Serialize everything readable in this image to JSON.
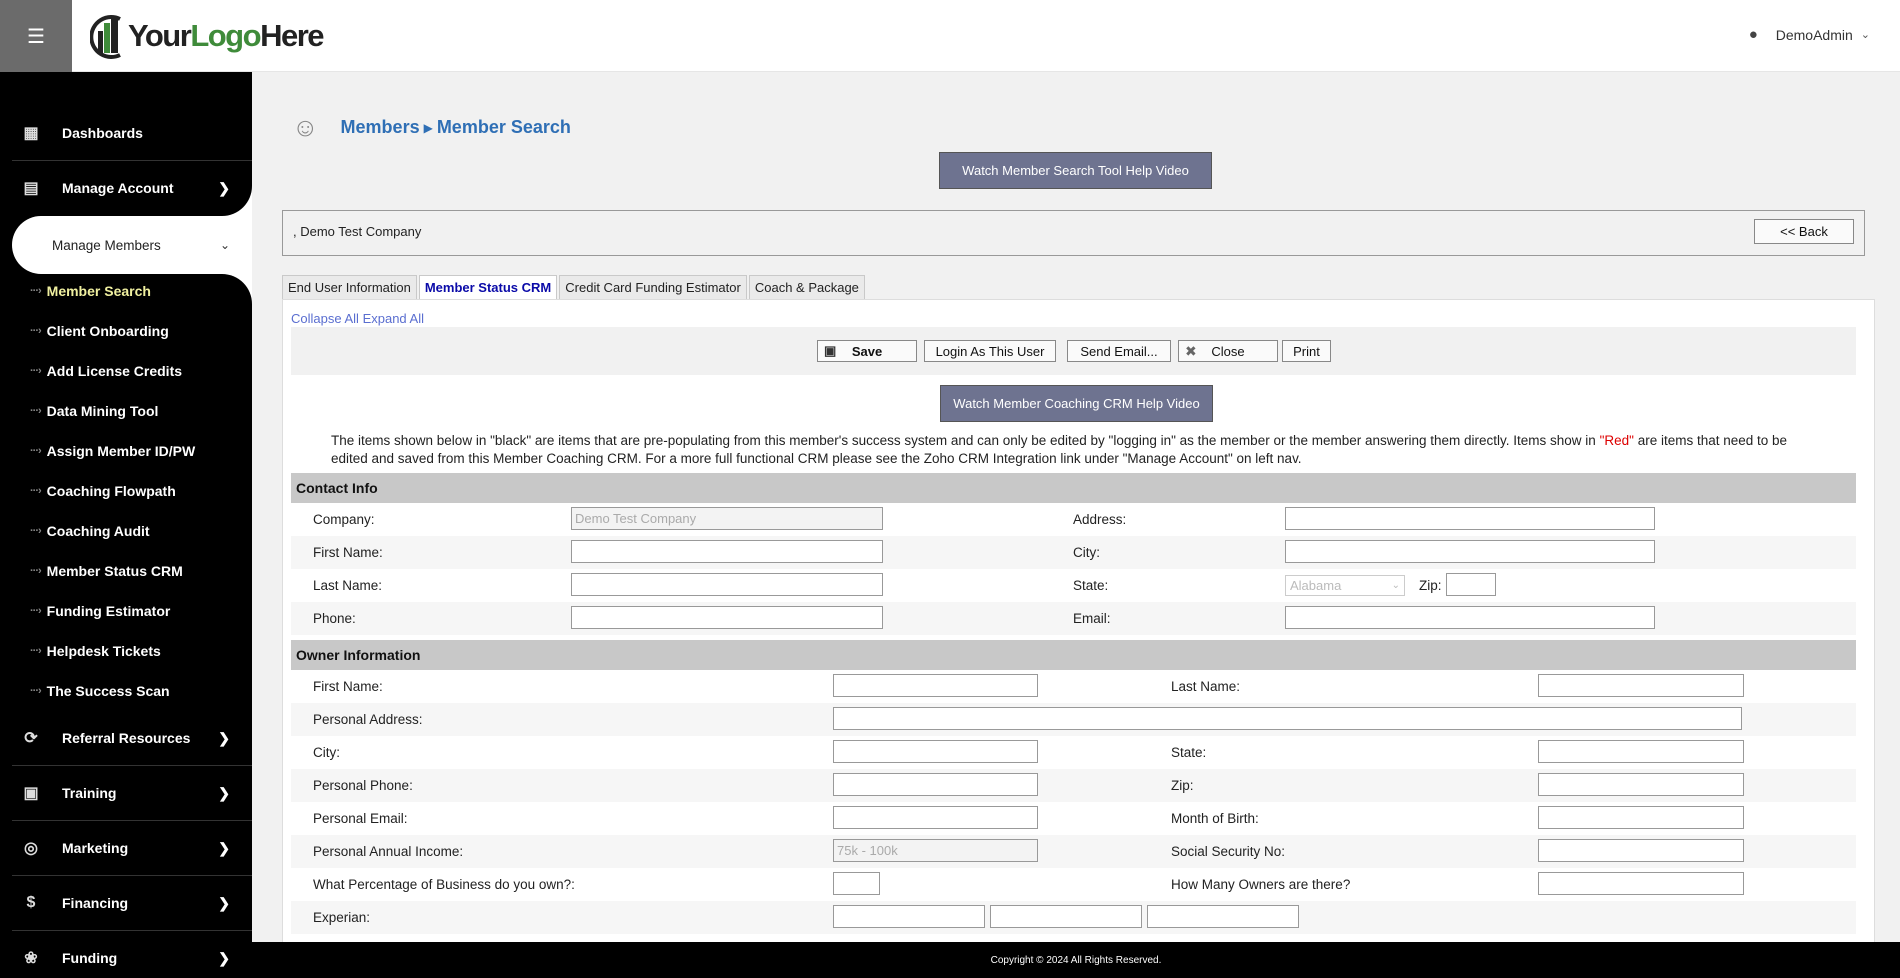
{
  "header": {
    "user_name": "DemoAdmin",
    "logo": {
      "your": "Your",
      "logo": "Logo",
      "here": "Here"
    }
  },
  "sidebar": {
    "items": [
      {
        "label": "Dashboards",
        "icon": "dashboard-grid-icon"
      },
      {
        "label": "Manage Account",
        "icon": "chart-icon"
      },
      {
        "label": "Manage Members"
      },
      {
        "label": "Referral Resources",
        "icon": "referral-icon"
      },
      {
        "label": "Training",
        "icon": "presentation-icon"
      },
      {
        "label": "Marketing",
        "icon": "target-icon"
      },
      {
        "label": "Financing",
        "icon": "money-icon"
      },
      {
        "label": "Funding",
        "icon": "funding-icon"
      }
    ],
    "subitems": [
      "Member Search",
      "Client Onboarding",
      "Add License Credits",
      "Data Mining Tool",
      "Assign Member ID/PW",
      "Coaching Flowpath",
      "Coaching Audit",
      "Member Status CRM",
      "Funding Estimator",
      "Helpdesk Tickets",
      "The Success Scan"
    ]
  },
  "breadcrumb": {
    "part1": "Members",
    "part2": "Member Search"
  },
  "help_video_button": "Watch Member Search Tool Help Video",
  "company_bar": {
    "name": ", Demo Test Company",
    "back_label": "<< Back"
  },
  "tabs": [
    "End User Information",
    "Member Status CRM",
    "Credit Card Funding Estimator",
    "Coach & Package"
  ],
  "panel": {
    "collapse_all": "Collapse All",
    "expand_all": "Expand All",
    "buttons": {
      "save": "Save",
      "login_as": "Login As This User",
      "send_email": "Send Email...",
      "close": "Close",
      "print": "Print"
    },
    "coaching_video_button": "Watch Member Coaching CRM Help Video",
    "note_part1": "The items shown below in \"black\" are items that are pre-populating from this member's success system and can only be edited by \"logging in\" as the member or the member answering them directly. Items show in ",
    "note_red": "\"Red\"",
    "note_part2": " are items that need to be edited and saved from this Member Coaching CRM. For a more full functional CRM please see the Zoho CRM Integration link under \"Manage Account\" on left nav."
  },
  "contact_info": {
    "title": "Contact Info",
    "company_label": "Company:",
    "company_value": "Demo Test Company",
    "first_name_label": "First Name:",
    "last_name_label": "Last Name:",
    "phone_label": "Phone:",
    "address_label": "Address:",
    "city_label": "City:",
    "state_label": "State:",
    "state_value": "Alabama",
    "zip_label": "Zip:",
    "email_label": "Email:"
  },
  "owner_info": {
    "title": "Owner Information",
    "first_name_label": "First Name:",
    "last_name_label": "Last Name:",
    "personal_address_label": "Personal Address:",
    "city_label": "City:",
    "state_label": "State:",
    "personal_phone_label": "Personal Phone:",
    "zip_label": "Zip:",
    "personal_email_label": "Personal Email:",
    "month_of_birth_label": "Month of Birth:",
    "annual_income_label": "Personal Annual Income:",
    "annual_income_value": "75k - 100k",
    "ssn_label": "Social Security No:",
    "percentage_label": "What Percentage of Business do you own?:",
    "owners_count_label": "How Many Owners are there?",
    "experian_label": "Experian:"
  },
  "footer": {
    "copyright": "Copyright © 2024 All Rights Reserved."
  }
}
